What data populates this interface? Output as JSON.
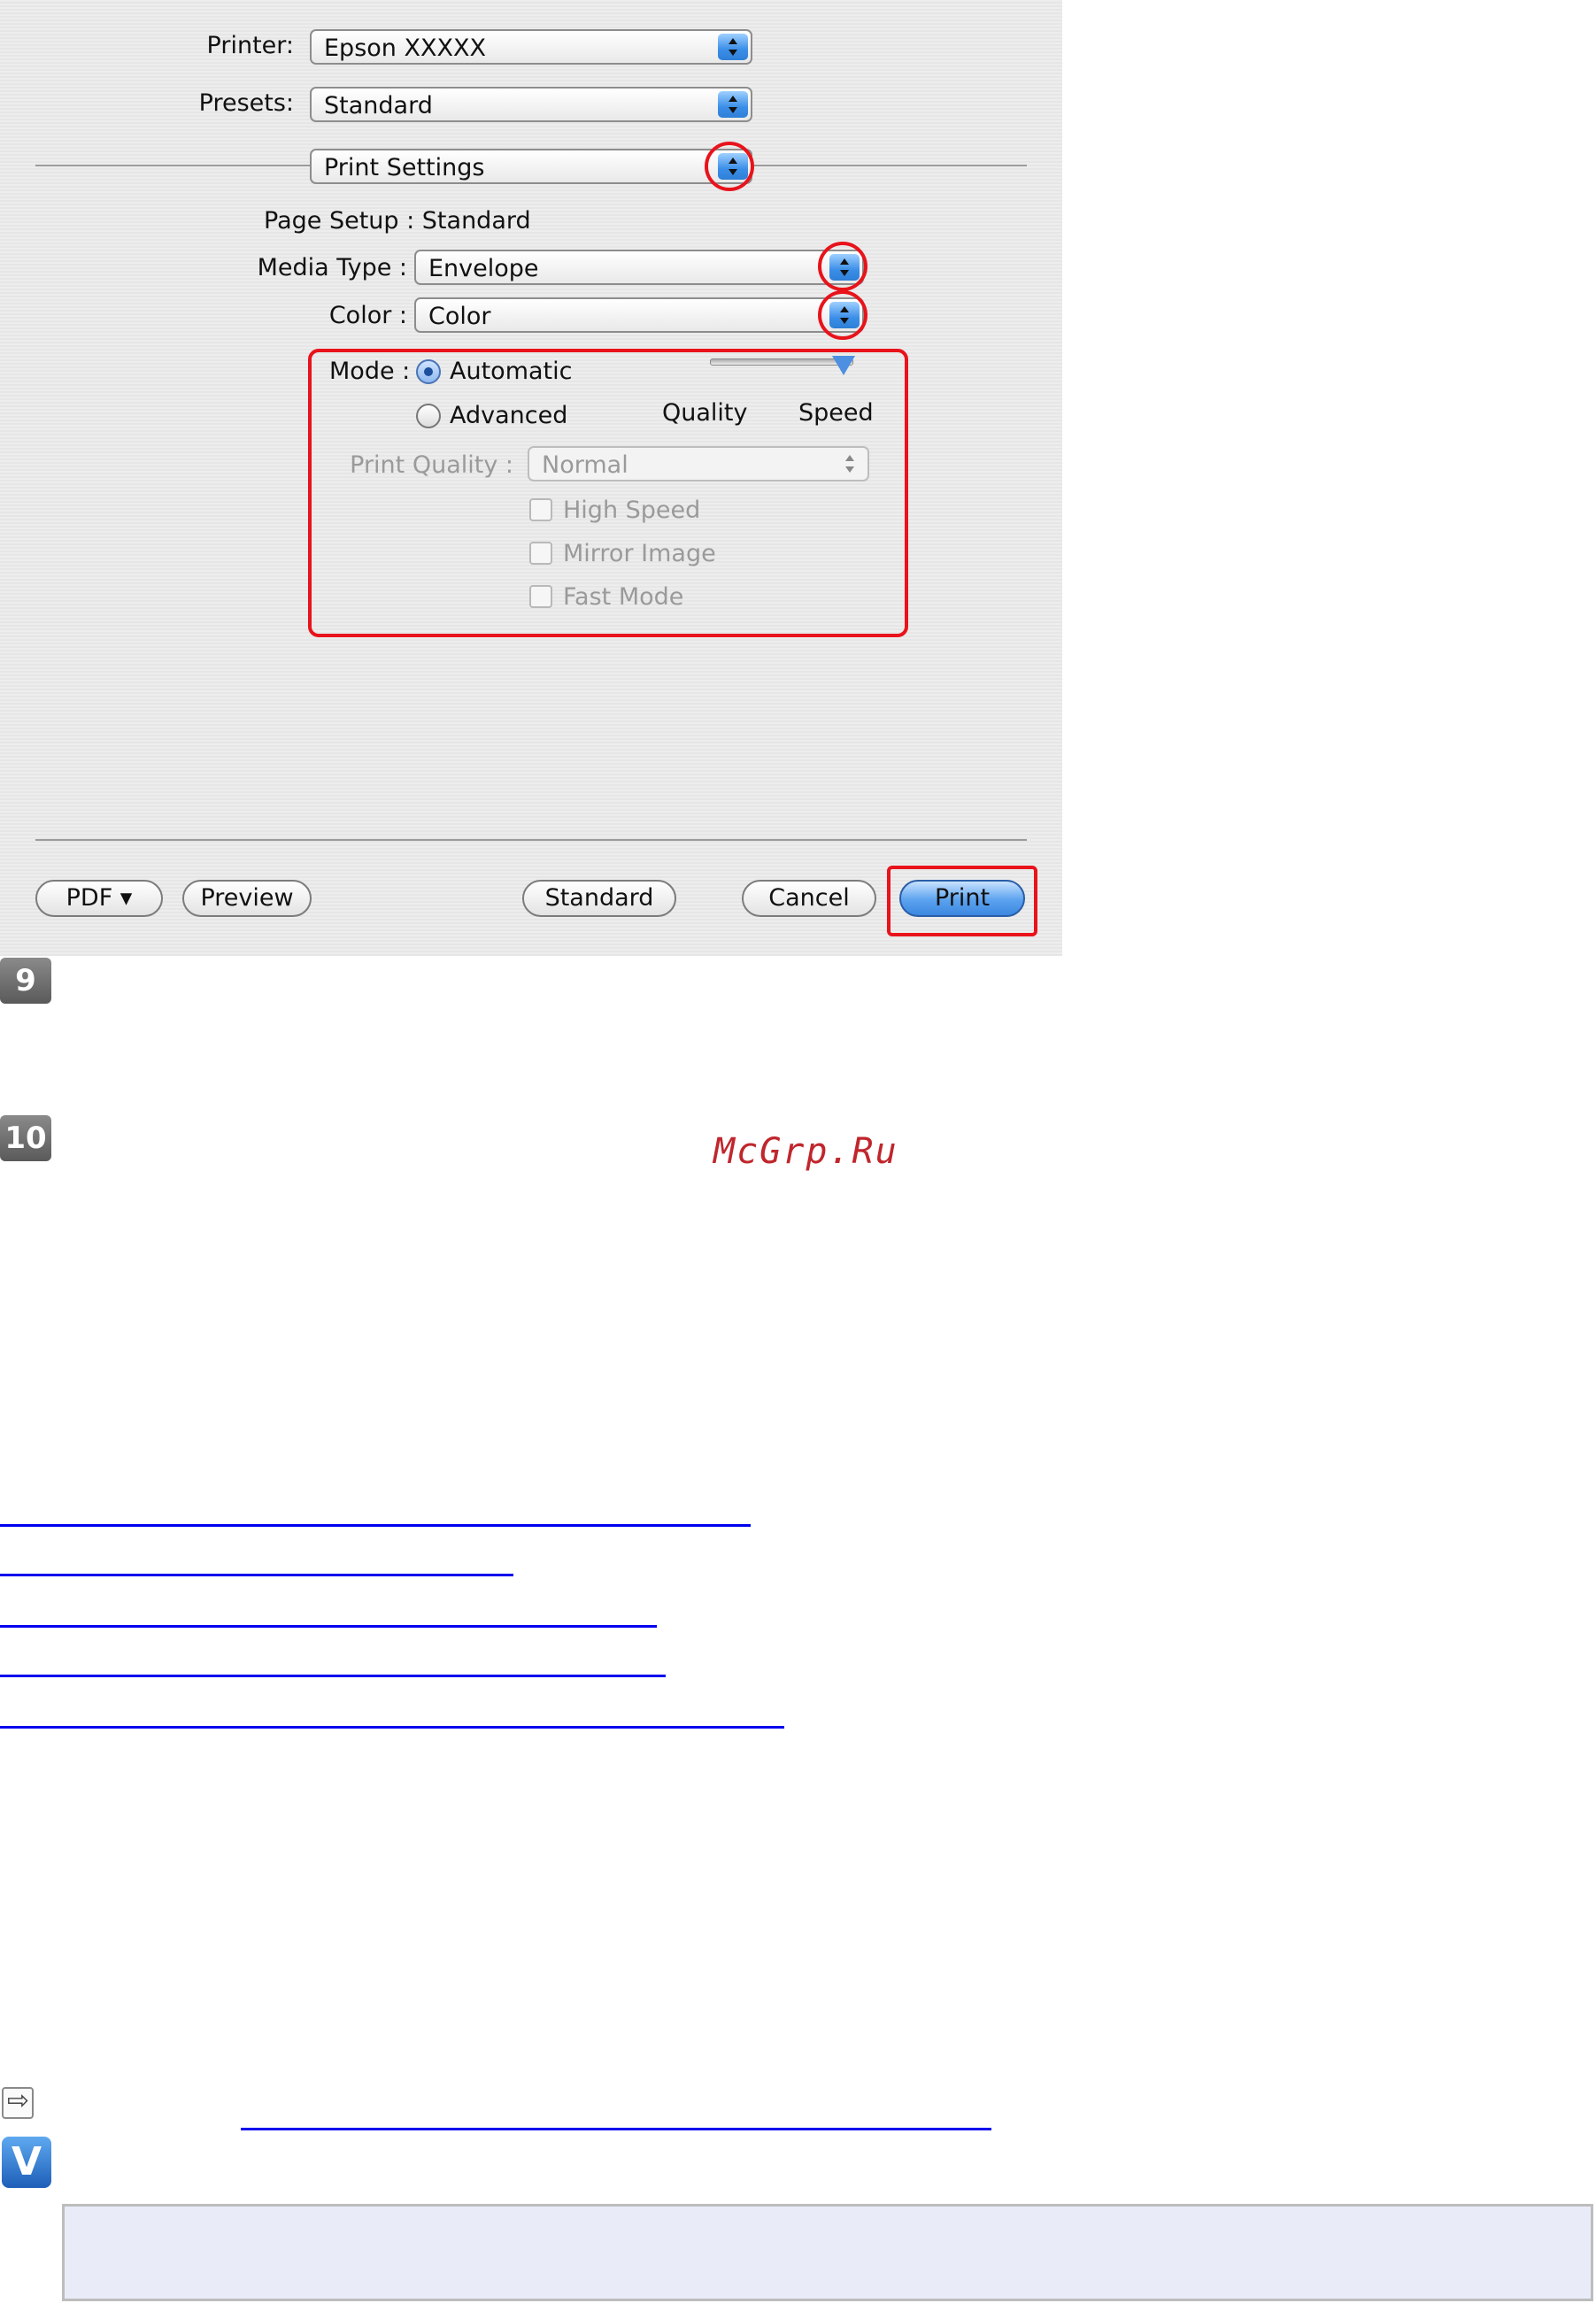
{
  "dialog": {
    "printer_label": "Printer:",
    "printer_value": "Epson  XXXXX",
    "presets_label": "Presets:",
    "presets_value": "Standard",
    "panel_value": "Print Settings",
    "page_setup_text": "Page Setup : Standard",
    "media_type_label": "Media Type :",
    "media_type_value": "Envelope",
    "color_label": "Color :",
    "color_value": "Color",
    "mode_label": "Mode :",
    "mode_automatic": "Automatic",
    "mode_advanced": "Advanced",
    "slider_quality": "Quality",
    "slider_speed": "Speed",
    "slider_level": 1.0,
    "print_quality_label": "Print Quality :",
    "print_quality_value": "Normal",
    "high_speed": "High Speed",
    "mirror_image": "Mirror Image",
    "fast_mode": "Fast Mode",
    "buttons": {
      "pdf": "PDF ▾",
      "preview": "Preview",
      "standard": "Standard",
      "cancel": "Cancel",
      "print": "Print"
    }
  },
  "steps": {
    "nine": "9",
    "ten": "10"
  },
  "watermark": "McGrp.Ru",
  "icons": {
    "arrow": "arrow-right-icon",
    "v": "V"
  },
  "colors": {
    "highlight": "#e8131b",
    "accent": "#3b8ee8",
    "link": "#0000ee"
  }
}
